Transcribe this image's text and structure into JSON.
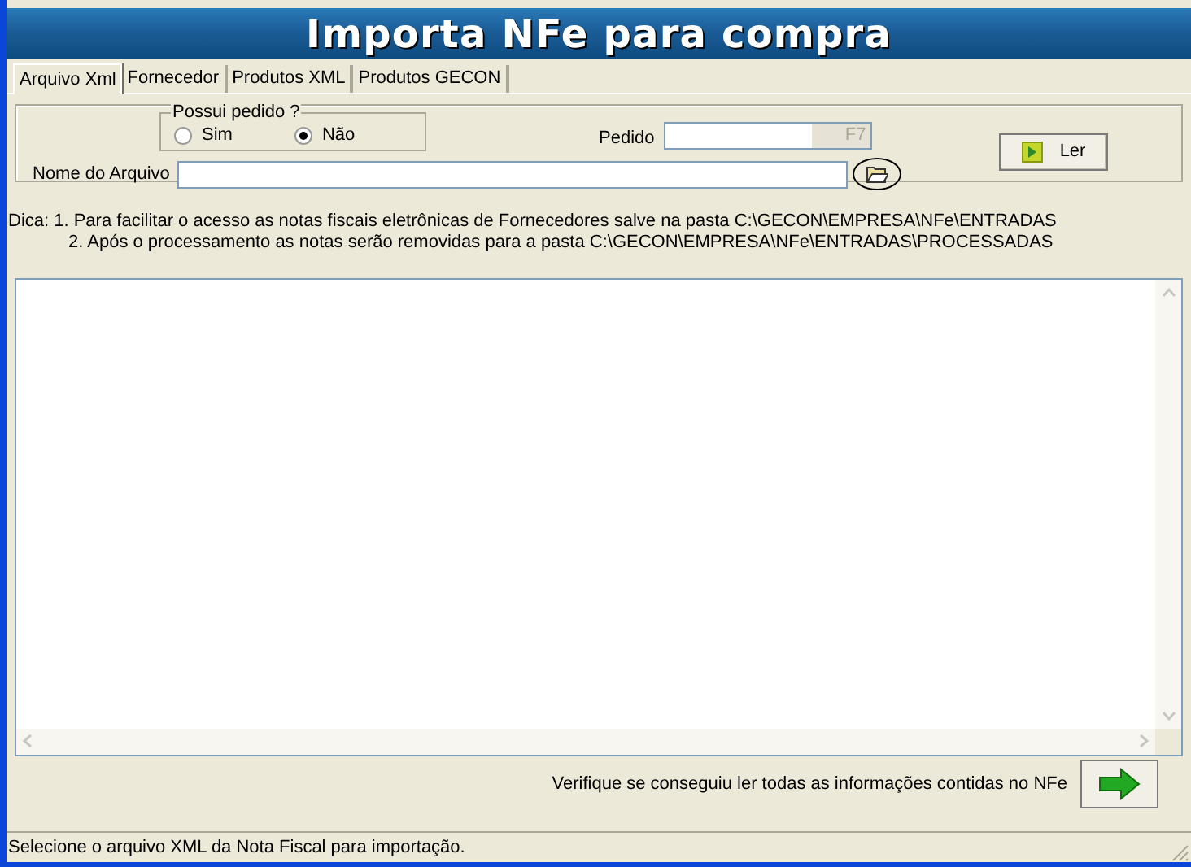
{
  "header": {
    "title": "Importa NFe para compra"
  },
  "tabs": [
    {
      "label": "Arquivo Xml",
      "selected": true
    },
    {
      "label": "Fornecedor",
      "selected": false
    },
    {
      "label": "Produtos XML",
      "selected": false
    },
    {
      "label": "Produtos GECON",
      "selected": false
    }
  ],
  "order_group": {
    "legend": "Possui pedido ?",
    "options": [
      {
        "label": "Sim",
        "selected": false
      },
      {
        "label": "Não",
        "selected": true
      }
    ]
  },
  "order_field": {
    "label": "Pedido",
    "key_hint": "F7"
  },
  "file_field": {
    "label": "Nome do Arquivo"
  },
  "read_button": {
    "label": "Ler"
  },
  "tips": [
    "Dica: 1. Para facilitar o acesso as notas fiscais eletrônicas de Fornecedores salve na pasta C:\\GECON\\EMPRESA\\NFe\\ENTRADAS",
    "2. Após o processamento as notas serão removidas para a pasta C:\\GECON\\EMPRESA\\NFe\\ENTRADAS\\PROCESSADAS"
  ],
  "footer": {
    "hint": "Verifique se conseguiu ler todas as informações contidas no NFe"
  },
  "status_bar": "Selecione o arquivo XML da Nota Fiscal para importação."
}
